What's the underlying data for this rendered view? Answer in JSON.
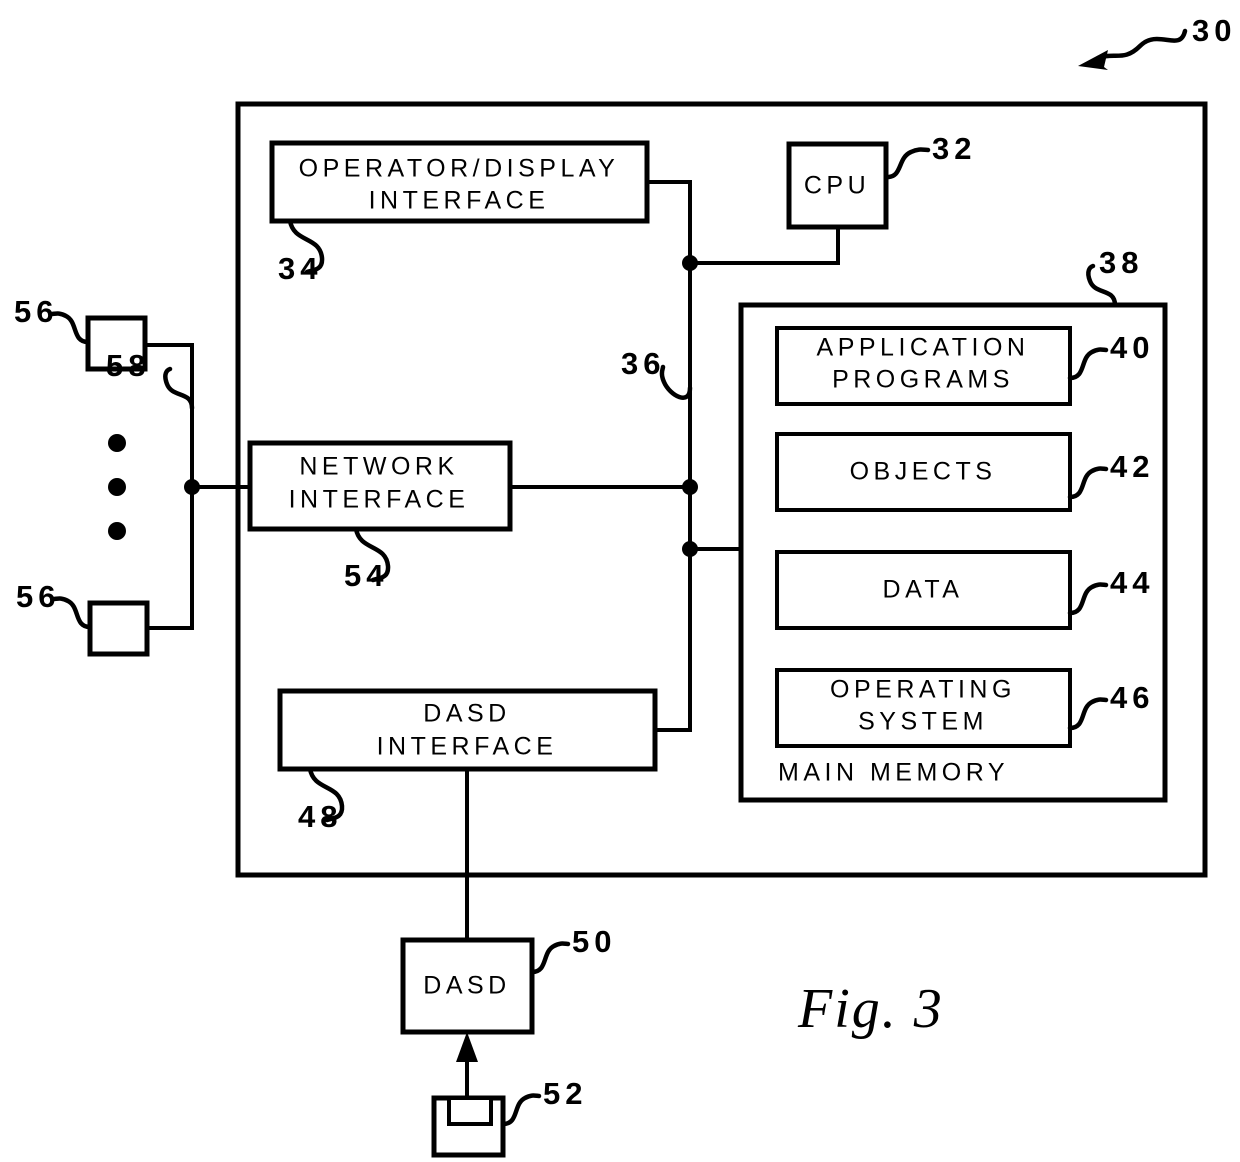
{
  "figure": {
    "caption": "Fig. 3",
    "system_ref": "30"
  },
  "enclosure": {
    "name": "computer-system-enclosure",
    "ref": "30"
  },
  "blocks": {
    "operator_display": {
      "line1": "OPERATOR/DISPLAY",
      "line2": "INTERFACE",
      "ref": "34"
    },
    "cpu": {
      "label": "CPU",
      "ref": "32"
    },
    "bus": {
      "ref": "36"
    },
    "main_memory": {
      "label": "MAIN MEMORY",
      "ref": "38"
    },
    "application_programs": {
      "line1": "APPLICATION",
      "line2": "PROGRAMS",
      "ref": "40"
    },
    "objects": {
      "label": "OBJECTS",
      "ref": "42"
    },
    "data": {
      "label": "DATA",
      "ref": "44"
    },
    "operating_system": {
      "line1": "OPERATING",
      "line2": "SYSTEM",
      "ref": "46"
    },
    "network_interface": {
      "line1": "NETWORK",
      "line2": "INTERFACE",
      "ref": "54"
    },
    "dasd_interface": {
      "line1": "DASD",
      "line2": "INTERFACE",
      "ref": "48"
    },
    "dasd": {
      "label": "DASD",
      "ref": "50"
    },
    "diskette": {
      "label": "",
      "ref": "52"
    },
    "terminal_top": {
      "label": "",
      "ref": "56"
    },
    "terminal_bottom": {
      "label": "",
      "ref": "56"
    },
    "network_line": {
      "ref": "58"
    }
  }
}
